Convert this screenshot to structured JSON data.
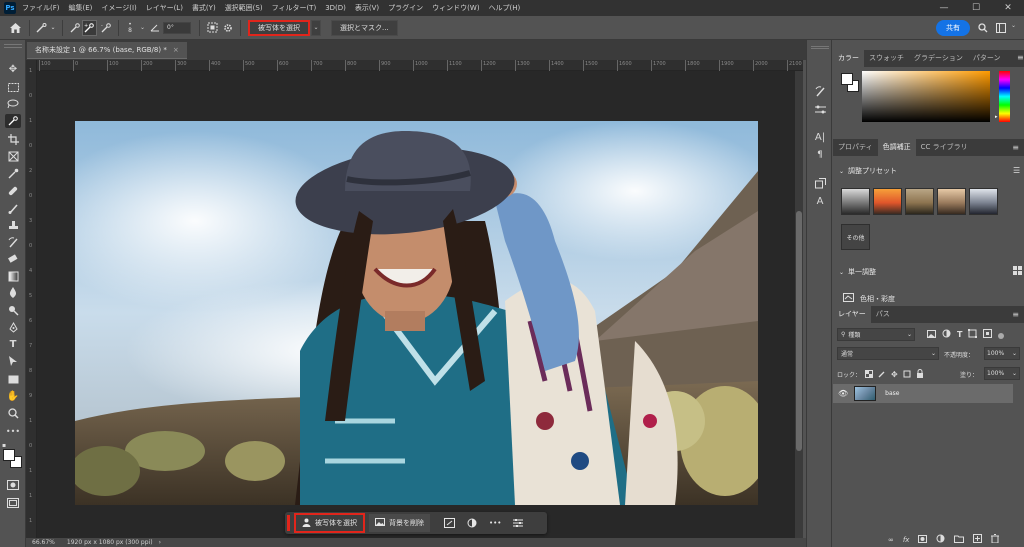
{
  "app": {
    "logo": "Ps"
  },
  "menu": [
    "ファイル(F)",
    "編集(E)",
    "イメージ(I)",
    "レイヤー(L)",
    "書式(Y)",
    "選択範囲(S)",
    "フィルター(T)",
    "3D(D)",
    "表示(V)",
    "プラグイン",
    "ウィンドウ(W)",
    "ヘルプ(H)"
  ],
  "window_controls": {
    "minimize": "—",
    "maximize": "☐",
    "close": "✕"
  },
  "options": {
    "brush_size": "8",
    "angle": "0°",
    "select_subject": "被写体を選択",
    "select_mask": "選択とマスク...",
    "share": "共有"
  },
  "document": {
    "tab_title": "名称未設定 1 @ 66.7% (base, RGB/8) *",
    "close": "×",
    "zoom": "66.67%",
    "info": "1920 px x 1080 px (300 ppi)"
  },
  "ruler_top_ticks": [
    "100",
    "0",
    "100",
    "200",
    "300",
    "400",
    "500",
    "600",
    "700",
    "800",
    "900",
    "1000",
    "1100",
    "1200",
    "1300",
    "1400",
    "1500",
    "1600",
    "1700",
    "1800",
    "1900",
    "2000",
    "2100"
  ],
  "ruler_left_ticks": [
    "1",
    "0",
    "1",
    "0",
    "2",
    "0",
    "3",
    "0",
    "4",
    "5",
    "6",
    "7",
    "8",
    "9",
    "1",
    "0",
    "1",
    "1",
    "1"
  ],
  "taskbar": {
    "select_subject": "被写体を選択",
    "remove_bg": "背景を削除",
    "more": "•••"
  },
  "color_panel": {
    "tabs": [
      "カラー",
      "スウォッチ",
      "グラデーション",
      "パターン"
    ],
    "active_tab": 0,
    "hue_color": "#ff9a00"
  },
  "adjust_panel": {
    "tabs": [
      "プロパティ",
      "色調補正",
      "CC ライブラリ"
    ],
    "active_tab": 1,
    "presets_title": "調整プリセット",
    "more_label": "その他",
    "single_title": "単一調整",
    "hue_sat": "色相・彩度"
  },
  "layers_panel": {
    "tabs": [
      "レイヤー",
      "パス"
    ],
    "active_tab": 0,
    "filter_kind": "種類",
    "blend_mode": "通常",
    "opacity_label": "不透明度：",
    "opacity_value": "100%",
    "lock_label": "ロック：",
    "fill_label": "塗り：",
    "fill_value": "100%",
    "layers": [
      {
        "name": "base",
        "visible": true
      }
    ]
  }
}
